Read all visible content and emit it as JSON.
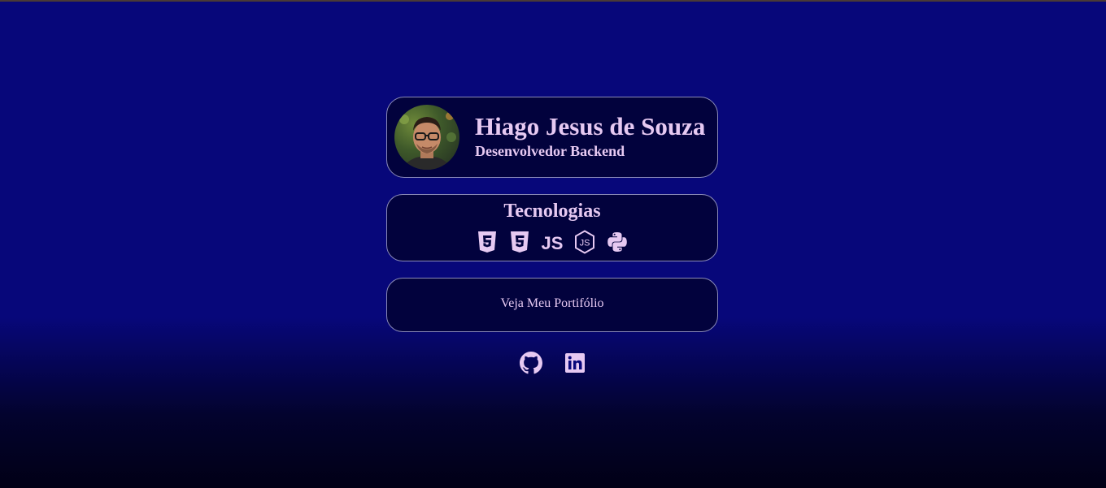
{
  "profile": {
    "name": "Hiago Jesus de Souza",
    "role": "Desenvolvedor Backend",
    "avatar_icon": "profile-photo"
  },
  "technologies": {
    "title": "Tecnologias",
    "icons": [
      "html5-icon",
      "css3-icon",
      "javascript-icon",
      "nodejs-icon",
      "python-icon"
    ]
  },
  "portfolio": {
    "label": "Veja Meu Portifólio"
  },
  "social": {
    "icons": [
      "github-icon",
      "linkedin-icon"
    ]
  },
  "colors": {
    "background_top": "#07077a",
    "background_bottom": "#010016",
    "card_background": "#02023d",
    "card_border": "#8a8ab8",
    "text": "#e6c9f2"
  }
}
